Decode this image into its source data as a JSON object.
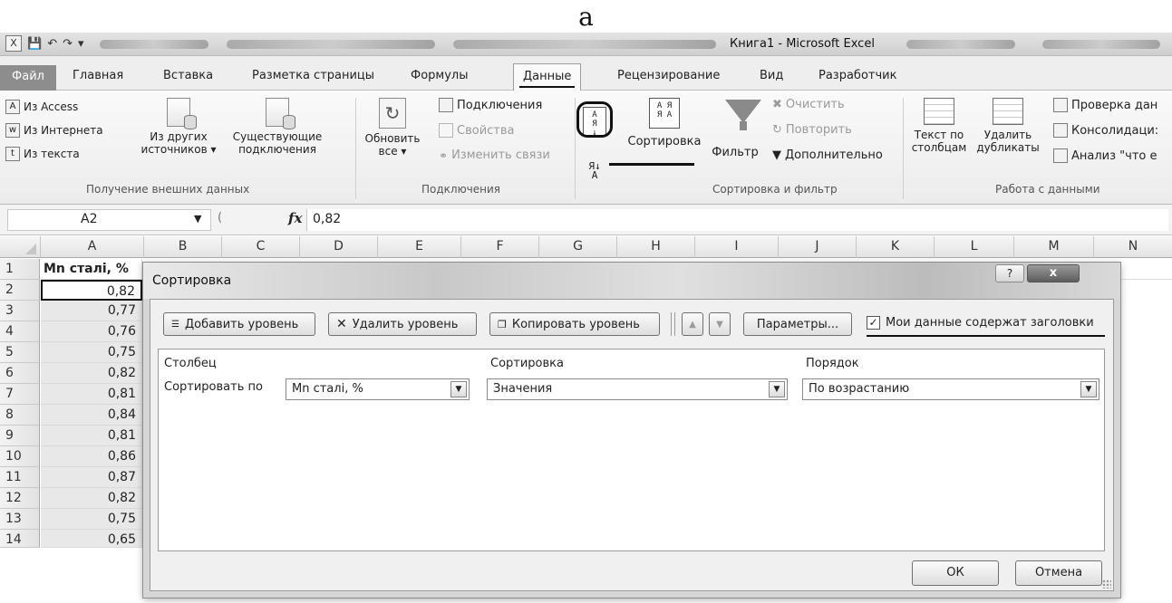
{
  "figure_label": "а",
  "window": {
    "title": "Книга1 - Microsoft Excel"
  },
  "ribbon_tabs": [
    {
      "label": "Файл"
    },
    {
      "label": "Главная"
    },
    {
      "label": "Вставка"
    },
    {
      "label": "Разметка страницы"
    },
    {
      "label": "Формулы"
    },
    {
      "label": "Данные",
      "active": true
    },
    {
      "label": "Рецензирование"
    },
    {
      "label": "Вид"
    },
    {
      "label": "Разработчик"
    }
  ],
  "ribbon": {
    "external": {
      "access": "Из Access",
      "web": "Из Интернета",
      "text": "Из текста",
      "other_line1": "Из других",
      "other_line2": "источников ▾",
      "existing_line1": "Существующие",
      "existing_line2": "подключения",
      "group_label": "Получение внешних данных"
    },
    "connections": {
      "refresh_line1": "Обновить",
      "refresh_line2": "все ▾",
      "connections": "Подключения",
      "properties": "Свойства",
      "edit_links": "Изменить связи",
      "group_label": "Подключения"
    },
    "sort_filter": {
      "sort": "Сортировка",
      "filter": "Фильтр",
      "clear": "Очистить",
      "reapply": "Повторить",
      "advanced": "Дополнительно",
      "group_label": "Сортировка и фильтр"
    },
    "data_tools": {
      "text_to_cols_line1": "Текст по",
      "text_to_cols_line2": "столбцам",
      "remove_dup_line1": "Удалить",
      "remove_dup_line2": "дубликаты",
      "validation": "Проверка дан",
      "consolidate": "Консолидаци:",
      "whatif": "Анализ \"что е",
      "group_label": "Работа с данными"
    }
  },
  "formula_bar": {
    "name_box": "A2",
    "fx": "fx",
    "value": "0,82"
  },
  "sheet": {
    "columns": [
      "A",
      "B",
      "C",
      "D",
      "E",
      "F",
      "G",
      "H",
      "I",
      "J",
      "K",
      "L",
      "M",
      "N"
    ],
    "rows": [
      {
        "n": "1",
        "a": "Mn сталі, %"
      },
      {
        "n": "2",
        "a": "0,82"
      },
      {
        "n": "3",
        "a": "0,77"
      },
      {
        "n": "4",
        "a": "0,76"
      },
      {
        "n": "5",
        "a": "0,75"
      },
      {
        "n": "6",
        "a": "0,82"
      },
      {
        "n": "7",
        "a": "0,81"
      },
      {
        "n": "8",
        "a": "0,84"
      },
      {
        "n": "9",
        "a": "0,81"
      },
      {
        "n": "10",
        "a": "0,86"
      },
      {
        "n": "11",
        "a": "0,87"
      },
      {
        "n": "12",
        "a": "0,82"
      },
      {
        "n": "13",
        "a": "0,75"
      },
      {
        "n": "14",
        "a": "0,65"
      }
    ]
  },
  "dialog": {
    "title": "Сортировка",
    "help": "?",
    "close": "x",
    "add_level": "Добавить уровень",
    "delete_level": "Удалить уровень",
    "copy_level": "Копировать уровень",
    "options": "Параметры...",
    "has_headers_label": "Мои данные содержат заголовки",
    "has_headers_checked": true,
    "col_header_column": "Столбец",
    "col_header_sort_on": "Сортировка",
    "col_header_order": "Порядок",
    "row_label": "Сортировать по",
    "column_value": "Mn сталі, %",
    "sort_on_value": "Значения",
    "order_value": "По возрастанию",
    "ok": "ОК",
    "cancel": "Отмена"
  }
}
